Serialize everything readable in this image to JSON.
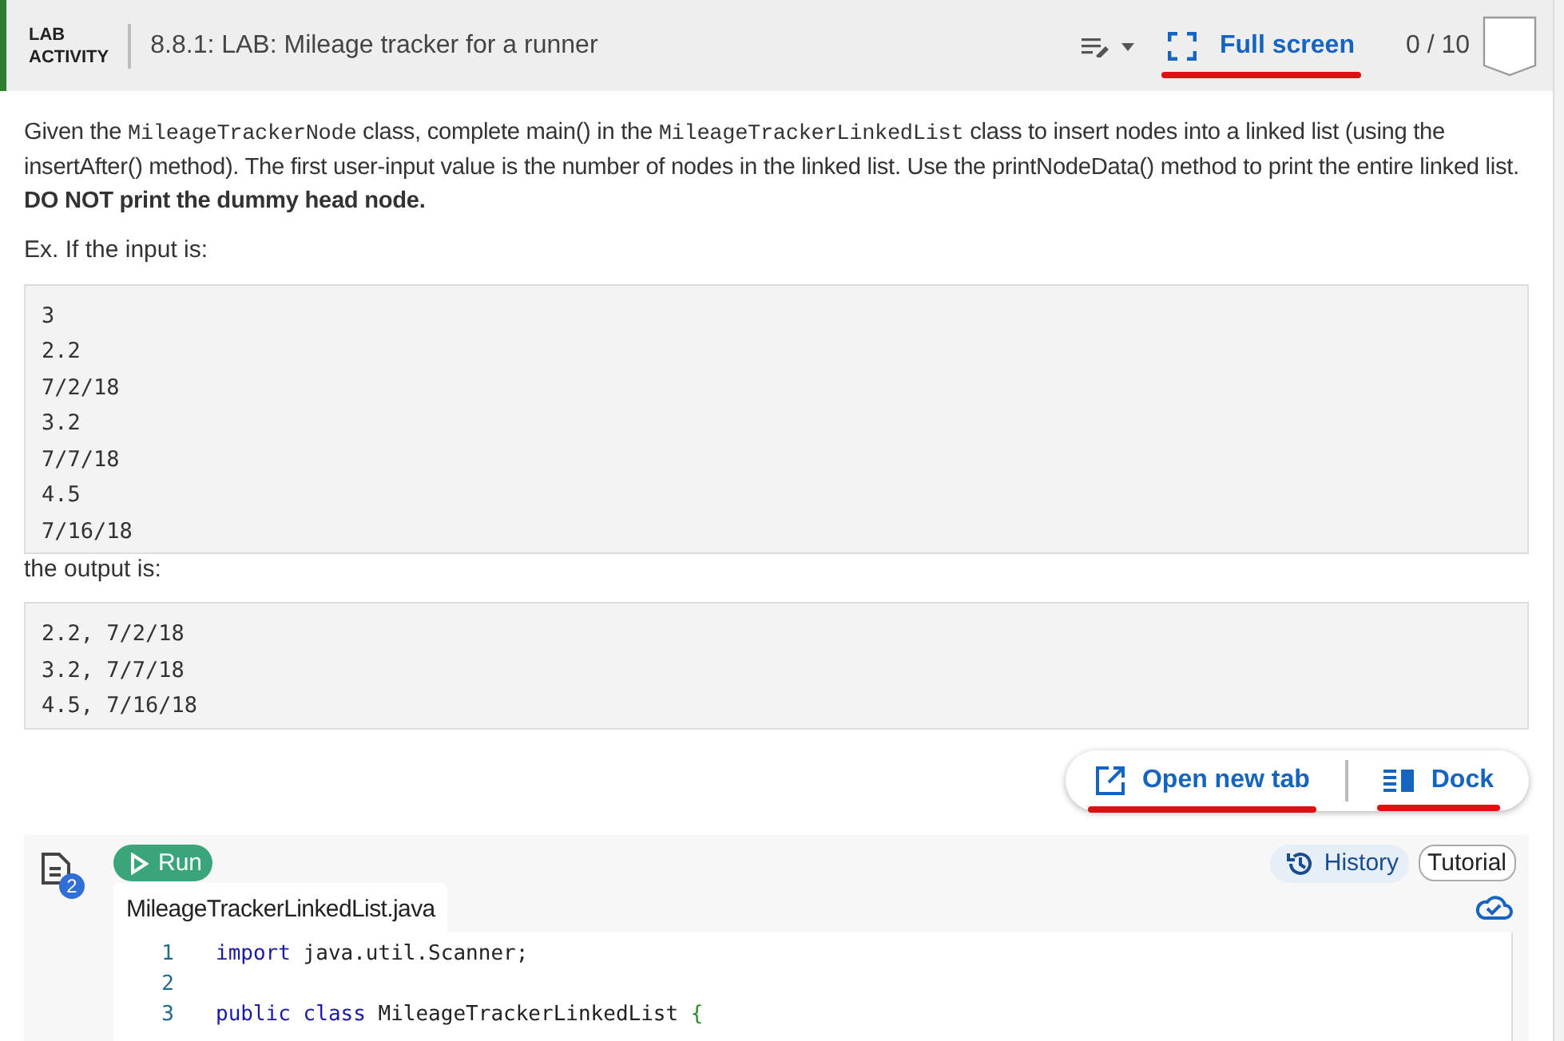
{
  "header": {
    "badge_line_1": "LAB",
    "badge_line_2": "ACTIVITY",
    "title": "8.8.1: LAB: Mileage tracker for a runner",
    "full_screen": "Full screen",
    "score": "0 / 10"
  },
  "instructions": {
    "parts": [
      {
        "kind": "text",
        "text": "Given the "
      },
      {
        "kind": "code",
        "text": "MileageTrackerNode"
      },
      {
        "kind": "text",
        "text": " class, complete main() in the "
      },
      {
        "kind": "code",
        "text": "MileageTrackerLinkedList"
      },
      {
        "kind": "text",
        "text": " class to insert nodes into a linked list (using the insertAfter() method). The first user-input value is the number of nodes in the linked list. Use the printNodeData() method to print the entire linked list. "
      },
      {
        "kind": "bold",
        "text": "DO NOT print the dummy head node."
      }
    ],
    "example_label": "Ex. If the input is:",
    "input_lines": [
      "3",
      "2.2",
      "7/2/18",
      "3.2",
      "7/7/18",
      "4.5",
      "7/16/18"
    ],
    "output_label": "the output is:",
    "output_lines": [
      "2.2, 7/2/18",
      "3.2, 7/7/18",
      "4.5, 7/16/18"
    ]
  },
  "view_buttons": {
    "open_new_tab": "Open new tab",
    "dock": "Dock"
  },
  "editor": {
    "file_badge": "2",
    "run": "Run",
    "history": "History",
    "tutorial": "Tutorial",
    "file_tab": "MileageTrackerLinkedList.java",
    "lines": [
      {
        "number": "1",
        "tokens": [
          {
            "kind": "keyword",
            "text": "import"
          },
          {
            "kind": "plain",
            "text": " java.util.Scanner;"
          }
        ]
      },
      {
        "number": "2"
      },
      {
        "number": "3",
        "tokens": [
          {
            "kind": "keyword",
            "text": "public class"
          },
          {
            "kind": "plain",
            "text": " MileageTrackerLinkedList "
          },
          {
            "kind": "brace",
            "text": "{"
          }
        ]
      }
    ]
  }
}
